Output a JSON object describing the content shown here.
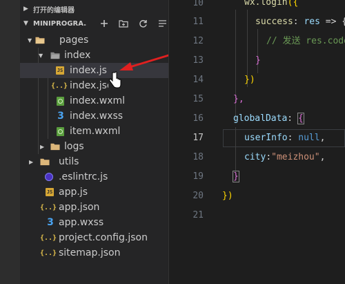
{
  "sidebar": {
    "open_editors_label": "打开的编辑器",
    "project_label": "MINIPROGRA...",
    "toolbar_icons": [
      "new-file-icon",
      "new-folder-icon",
      "refresh-icon",
      "collapse-all-icon"
    ],
    "tree": [
      {
        "label": "pages",
        "type": "folder",
        "expanded": true
      },
      {
        "label": "index",
        "type": "folder",
        "expanded": true
      },
      {
        "label": "index.js",
        "type": "js",
        "selected": true
      },
      {
        "label": "index.json",
        "type": "json"
      },
      {
        "label": "index.wxml",
        "type": "wxml"
      },
      {
        "label": "index.wxss",
        "type": "wxss"
      },
      {
        "label": "item.wxml",
        "type": "wxml"
      },
      {
        "label": "logs",
        "type": "folder",
        "expanded": false
      },
      {
        "label": "utils",
        "type": "folder",
        "expanded": false
      },
      {
        "label": ".eslintrc.js",
        "type": "eslint"
      },
      {
        "label": "app.js",
        "type": "js"
      },
      {
        "label": "app.json",
        "type": "json"
      },
      {
        "label": "app.wxss",
        "type": "wxss"
      },
      {
        "label": "project.config.json",
        "type": "json"
      },
      {
        "label": "sitemap.json",
        "type": "json"
      }
    ]
  },
  "icons": {
    "js": "JS",
    "json": "{..}",
    "css": "3"
  },
  "editor": {
    "line_numbers": [
      "10",
      "11",
      "12",
      "13",
      "14",
      "15",
      "16",
      "17",
      "18",
      "19",
      "20",
      "21"
    ],
    "active_line": "17",
    "lines": {
      "l10_fn": "wx.login",
      "l10_br": "({",
      "l11_prop": "success",
      "l11_rest": ": ",
      "l11_param": "res",
      "l11_arrow": " => {",
      "l12_cmt": "// 发送 res.code",
      "l13_br": "}",
      "l14_br": "})",
      "l15_br": "},",
      "l16_prop": "globalData",
      "l16_colon": ": ",
      "l16_br": "{",
      "l17_prop": "userInfo",
      "l17_colon": ": ",
      "l17_val": "null",
      "l17_comma": ",",
      "l18_prop": "city",
      "l18_colon": ":",
      "l18_val": "\"meizhou\"",
      "l18_comma": ",",
      "l19_br": "}",
      "l20_br": "})"
    }
  },
  "colors": {
    "sidebar_bg": "#252526",
    "editor_bg": "#1e1e1e",
    "selection_bg": "#37373d"
  }
}
